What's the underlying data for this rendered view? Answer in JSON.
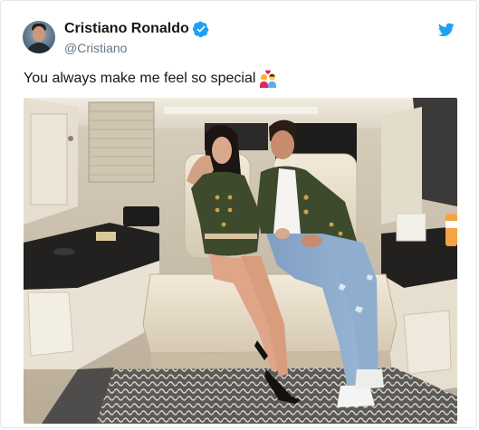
{
  "tweet": {
    "author_name": "Cristiano Ronaldo",
    "author_handle": "@Cristiano",
    "text": "You always make me feel so special",
    "verified": true
  },
  "icons": {
    "verified": "verified-badge-icon",
    "platform": "twitter-bird-icon",
    "emoji": "couple-with-heart-emoji"
  },
  "colors": {
    "twitter_blue": "#1da1f2",
    "name_text": "#14171a",
    "handle_text": "#657786",
    "border": "#e1e8ed"
  }
}
